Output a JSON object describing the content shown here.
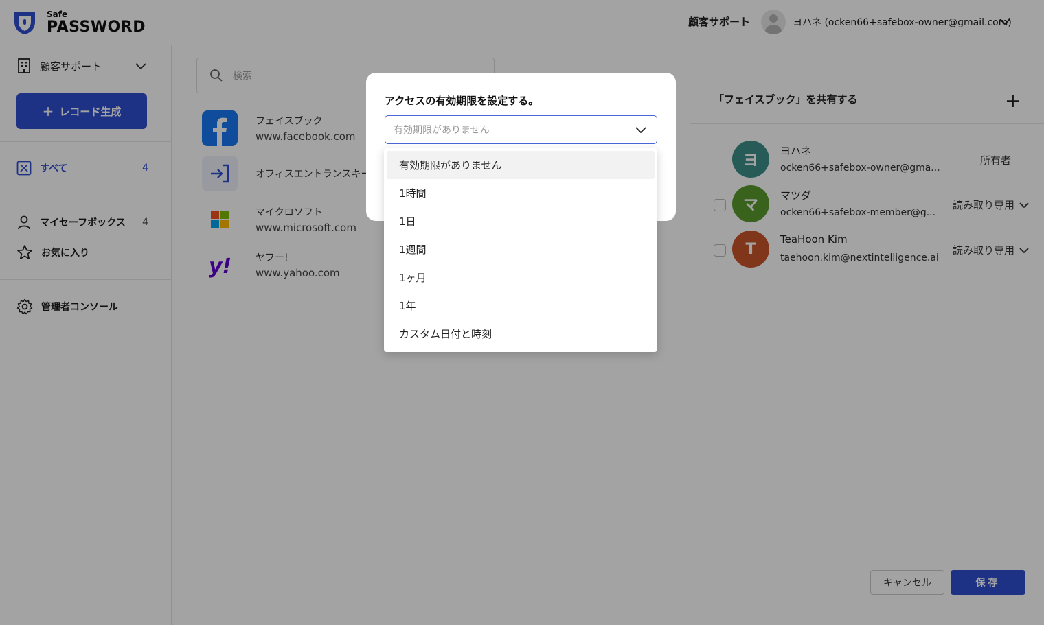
{
  "app": {
    "logo_top": "Safe",
    "logo_bottom": "PASSWORD"
  },
  "header": {
    "org_name": "顧客サポート",
    "user_label": "ヨハネ (ocken66+safebox-owner@gmail.com)"
  },
  "sidebar": {
    "org_select": "顧客サポート",
    "new_button": "レコード生成",
    "new_button_plus": "+",
    "items": [
      {
        "label": "すべて",
        "count": "4",
        "icon": "x-square-icon"
      },
      {
        "label": "マイセーフボックス",
        "count": "4",
        "icon": "user-icon"
      },
      {
        "label": "お気に入り",
        "count": "",
        "icon": "star-icon"
      },
      {
        "label": "管理者コンソール",
        "count": "",
        "icon": "gear-icon"
      }
    ]
  },
  "search": {
    "placeholder": "検索"
  },
  "records": [
    {
      "name": "フェイスブック",
      "url": "www.facebook.com",
      "icon": "facebook-icon"
    },
    {
      "name": "オフィスエントランスキー",
      "url": "",
      "icon": "login-arrow-icon"
    },
    {
      "name": "マイクロソフト",
      "url": "www.microsoft.com",
      "icon": "microsoft-icon"
    },
    {
      "name": "ヤフー!",
      "url": "www.yahoo.com",
      "icon": "yahoo-icon"
    }
  ],
  "share_panel": {
    "title": "「フェイスブック」を共有する",
    "add": "+",
    "members": [
      {
        "initial": "ヨ",
        "name": "ヨハネ",
        "email": "ocken66+safebox-owner@gma...",
        "role": "所有者",
        "color": "#3d8f8a"
      },
      {
        "initial": "マ",
        "name": "マツダ",
        "email": "ocken66+safebox-member@g...",
        "role": "読み取り専用",
        "color": "#5a9b2e"
      },
      {
        "initial": "T",
        "name": "TeaHoon Kim",
        "email": "taehoon.kim@nextintelligence.ai",
        "role": "読み取り専用",
        "color": "#c9552a"
      }
    ],
    "cancel": "キャンセル",
    "save": "保存"
  },
  "modal": {
    "title": "アクセスの有効期限を設定する。",
    "selected": "有効期限がありません",
    "options": [
      "有効期限がありません",
      "1時間",
      "1日",
      "1週間",
      "1ヶ月",
      "1年",
      "カスタム日付と時刻"
    ]
  },
  "colors": {
    "accent": "#2f4fd0",
    "focus": "#4a67d6"
  }
}
